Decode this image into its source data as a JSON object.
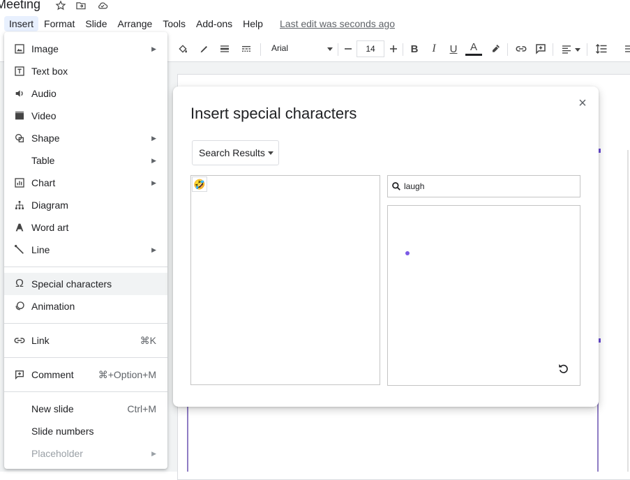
{
  "app": {
    "title": "Meeting",
    "last_edit": "Last edit was seconds ago"
  },
  "menubar": [
    "Insert",
    "Format",
    "Slide",
    "Arrange",
    "Tools",
    "Add-ons",
    "Help"
  ],
  "toolbar": {
    "font": "Arial",
    "font_size": "14"
  },
  "insert_menu": {
    "items": [
      {
        "label": "Image",
        "icon": "image-icon",
        "submenu": true
      },
      {
        "label": "Text box",
        "icon": "text-box-icon",
        "submenu": false
      },
      {
        "label": "Audio",
        "icon": "audio-icon",
        "submenu": false
      },
      {
        "label": "Video",
        "icon": "video-icon",
        "submenu": false
      },
      {
        "label": "Shape",
        "icon": "shape-icon",
        "submenu": true
      },
      {
        "label": "Table",
        "icon": "",
        "submenu": true
      },
      {
        "label": "Chart",
        "icon": "chart-icon",
        "submenu": true
      },
      {
        "label": "Diagram",
        "icon": "diagram-icon",
        "submenu": false
      },
      {
        "label": "Word art",
        "icon": "word-art-icon",
        "submenu": false
      },
      {
        "label": "Line",
        "icon": "line-icon",
        "submenu": true
      },
      {
        "label": "Special characters",
        "icon": "omega-icon",
        "submenu": false,
        "highlighted": true
      },
      {
        "label": "Animation",
        "icon": "animation-icon",
        "submenu": false
      },
      {
        "label": "Link",
        "icon": "link-icon",
        "shortcut": "⌘K"
      },
      {
        "label": "Comment",
        "icon": "comment-icon",
        "shortcut": "⌘+Option+M"
      },
      {
        "label": "New slide",
        "icon": "",
        "shortcut": "Ctrl+M"
      },
      {
        "label": "Slide numbers",
        "icon": ""
      },
      {
        "label": "Placeholder",
        "icon": "",
        "submenu": true,
        "disabled": true
      }
    ]
  },
  "dialog": {
    "title": "Insert special characters",
    "category": "Search Results",
    "search_value": "laugh",
    "result_glyph": "🤣",
    "close_glyph": "×"
  }
}
